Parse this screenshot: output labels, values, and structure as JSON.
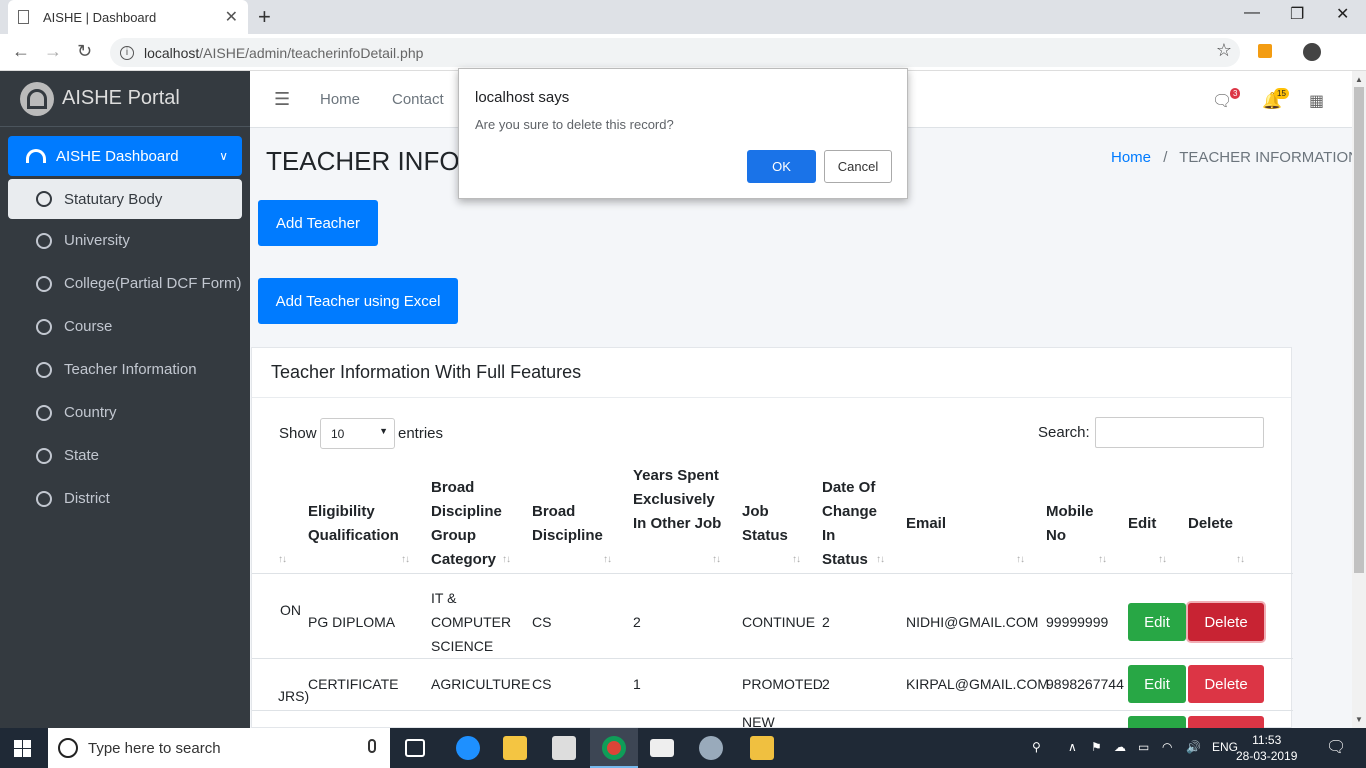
{
  "browser": {
    "tab_title": "AISHE | Dashboard",
    "url_host": "localhost",
    "url_path": "/AISHE/admin/teacherinfoDetail.php",
    "new_tab": "+",
    "tab_close": "✕",
    "minimize": "—",
    "maximize": "❐",
    "close": "✕",
    "back": "←",
    "forward": "→",
    "reload": "↻",
    "bookmark": "☆",
    "menu": "⋮"
  },
  "sidebar": {
    "brand": "AISHE Portal",
    "dashboard": "AISHE Dashboard",
    "items": [
      {
        "label": "Statutary Body"
      },
      {
        "label": "University"
      },
      {
        "label": "College(Partial DCF Form)"
      },
      {
        "label": "Course"
      },
      {
        "label": "Teacher Information"
      },
      {
        "label": "Country"
      },
      {
        "label": "State"
      },
      {
        "label": "District"
      }
    ]
  },
  "topnav": {
    "home": "Home",
    "contact": "Contact",
    "messages_count": "3",
    "notifications_count": "15"
  },
  "page": {
    "title": "TEACHER INFOR",
    "crumb_home": "Home",
    "crumb_sep": "/",
    "crumb_current": "TEACHER INFORMATION",
    "add_teacher": "Add Teacher",
    "add_excel": "Add Teacher using Excel"
  },
  "table": {
    "card_title": "Teacher Information With Full Features",
    "show": "Show",
    "entries_value": "10",
    "entries": "entries",
    "search": "Search:",
    "headers": [
      "Eligibility Qualification",
      "Broad Discipline Group Category",
      "Broad Discipline",
      "Years Spent Exclusively In Other Job",
      "Job Status",
      "Date Of Change In Status",
      "Email",
      "Mobile No",
      "Edit",
      "Delete"
    ],
    "rows": [
      {
        "pre": "ON",
        "qual": "PG DIPLOMA",
        "group": "IT & COMPUTER SCIENCE",
        "disc": "CS",
        "years": "2",
        "status": "CONTINUE",
        "date": "2",
        "email": "NIDHI@GMAIL.COM",
        "mobile": "99999999",
        "edit": "Edit",
        "delete": "Delete"
      },
      {
        "pre": "JRS)",
        "qual": "CERTIFICATE",
        "group": "AGRICULTURE",
        "disc": "CS",
        "years": "1",
        "status": "PROMOTED",
        "date": "2",
        "email": "KIRPAL@GMAIL.COM",
        "mobile": "9898267744",
        "edit": "Edit",
        "delete": "Delete"
      },
      {
        "status": "NEW"
      }
    ]
  },
  "dialog": {
    "title": "localhost says",
    "message": "Are you sure to delete this record?",
    "ok": "OK",
    "cancel": "Cancel"
  },
  "taskbar": {
    "search_placeholder": "Type here to search",
    "lang": "ENG",
    "time": "11:53",
    "date": "28-03-2019"
  },
  "colors": {
    "primary": "#007bff",
    "success": "#28a745",
    "danger": "#dc3545",
    "sidebar": "#343a40"
  }
}
